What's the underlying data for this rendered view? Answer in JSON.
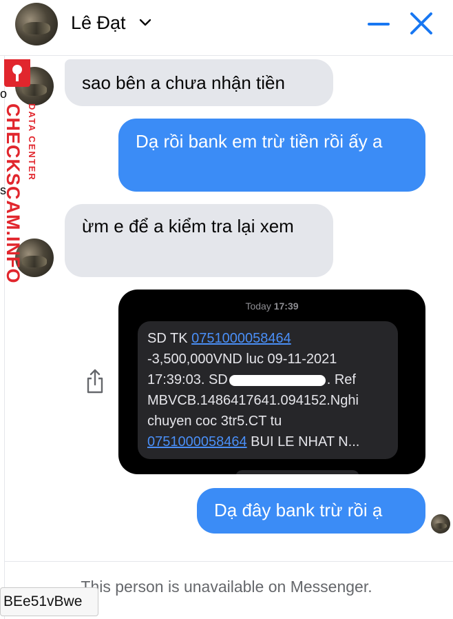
{
  "header": {
    "contact_name": "Lê Đạt"
  },
  "messages": [
    {
      "from": "contact",
      "text": "sao bên a chưa nhận tiền"
    },
    {
      "from": "me",
      "text": "Dạ rồi bank em trừ tiền rồi ấy a"
    },
    {
      "from": "contact",
      "text": "ừm e để a kiểm tra lại xem"
    },
    {
      "from": "me",
      "type": "image"
    },
    {
      "from": "me",
      "text": "Dạ đây bank trừ rồi ạ"
    }
  ],
  "sms_image": {
    "time_prefix": "Today",
    "time": "17:39",
    "prefix": "SD TK",
    "account": "0751000058464",
    "line2": "-3,500,000VND luc 09-11-2021",
    "line3_start": "17:39:03. SD",
    "line3_end": ". Ref",
    "line4": "MBVCB.1486417641.094152.Nghi",
    "line5": "chuyen coc 3tr5.CT tu",
    "account2": "0751000058464",
    "line6_end": " BUI LE NHAT N..."
  },
  "footer": {
    "status": "This person is unavailable on Messenger.",
    "code": "BEe51vBwe"
  },
  "watermark": {
    "main": "CHECKSCAM.INFO",
    "sub": "DATA CENTER"
  },
  "stray_chars": {
    "a": "o",
    "b": "s"
  },
  "colors": {
    "outgoing_bubble": "#3b8cf6",
    "incoming_bubble": "#e4e6eb",
    "header_icons": "#1877f2",
    "watermark": "#e1262d"
  },
  "icons": [
    "chevron-down-icon",
    "minimize-icon",
    "close-icon",
    "share-icon",
    "key-icon"
  ]
}
